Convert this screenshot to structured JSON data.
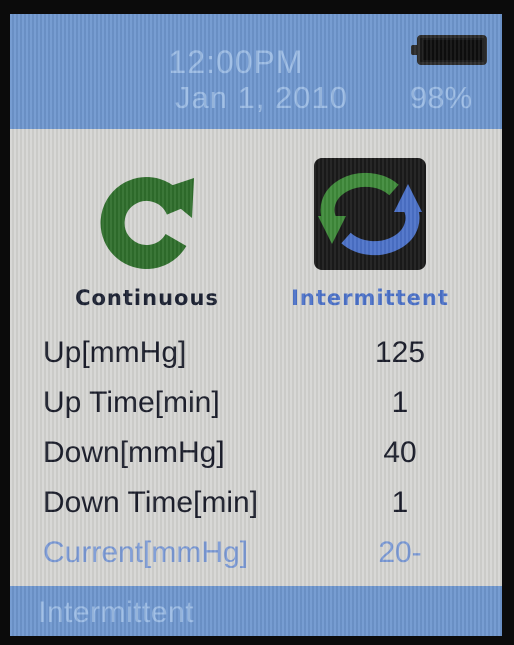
{
  "status_bar": {
    "time": "12:00PM",
    "date": "Jan 1, 2010",
    "battery_percent": "98%",
    "battery_level": 0.98
  },
  "modes": {
    "continuous": {
      "label": "Continuous",
      "icon": "refresh-arrow-icon",
      "color": "#2f6f2c"
    },
    "intermittent": {
      "label": "Intermittent",
      "icon": "cycle-arrows-icon",
      "selected": true,
      "color": "#4c72c9"
    }
  },
  "parameters": [
    {
      "label": "Up[mmHg]",
      "value": "125"
    },
    {
      "label": "Up Time[min]",
      "value": "1"
    },
    {
      "label": "Down[mmHg]",
      "value": "40"
    },
    {
      "label": "Down Time[min]",
      "value": "1"
    },
    {
      "label": "Current[mmHg]",
      "value": "20-"
    }
  ],
  "footer": {
    "mode_text": "Intermittent"
  },
  "colors": {
    "header_bg": "#6f97cf",
    "screen_bg": "#d6d6d3",
    "accent_text": "#7b9ad6"
  }
}
